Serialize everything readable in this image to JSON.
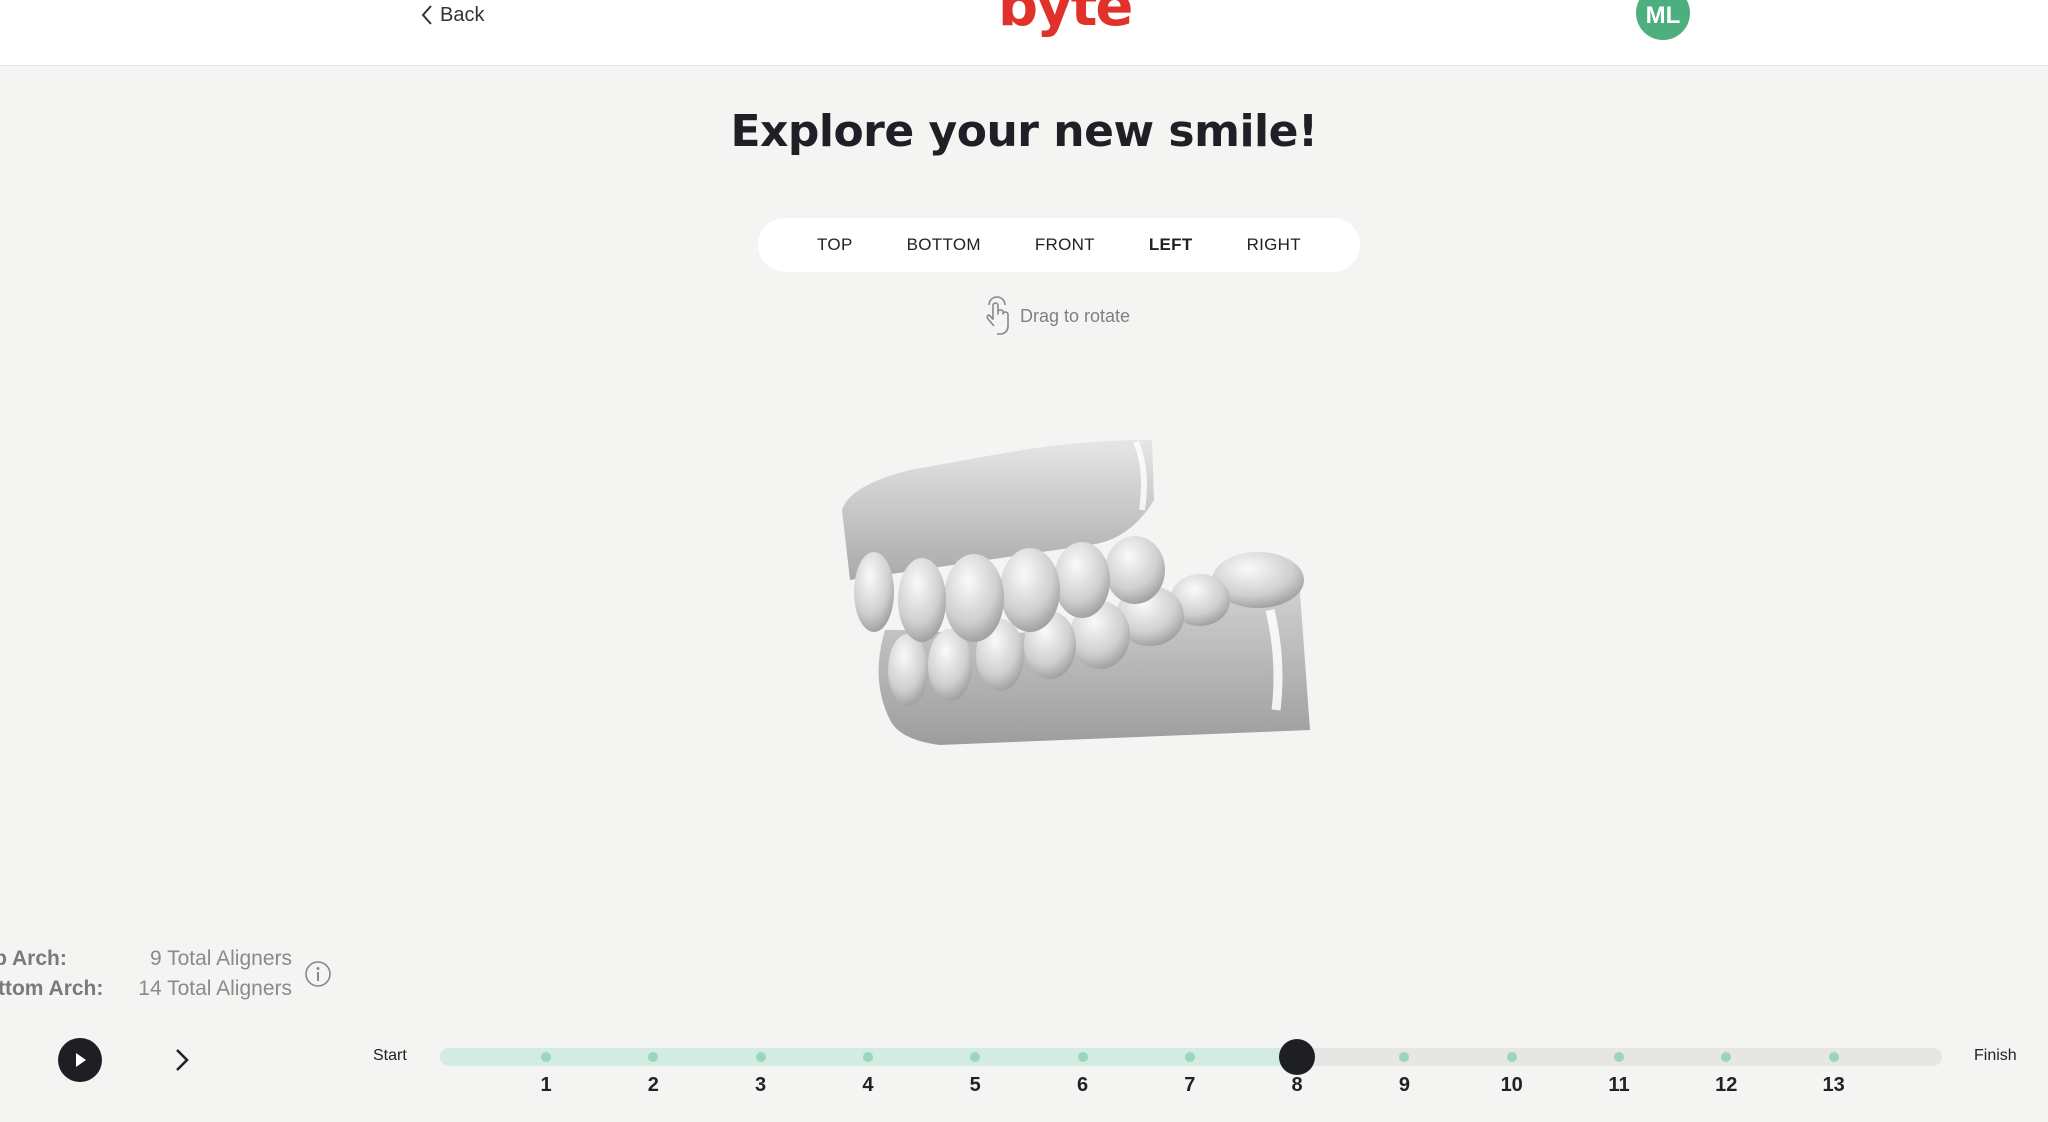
{
  "header": {
    "back_label": "Back",
    "logo_text": "byte",
    "avatar_initials": "ML",
    "avatar_color": "#4caf7d",
    "logo_color": "#e0312a"
  },
  "page": {
    "title": "Explore your new smile!"
  },
  "view_tabs": [
    {
      "label": "TOP",
      "active": false
    },
    {
      "label": "BOTTOM",
      "active": false
    },
    {
      "label": "FRONT",
      "active": false
    },
    {
      "label": "LEFT",
      "active": true
    },
    {
      "label": "RIGHT",
      "active": false
    }
  ],
  "drag_hint": {
    "icon": "hand-drag-icon",
    "text": "Drag to rotate"
  },
  "model": {
    "icon": "teeth-3d-model"
  },
  "aligners": {
    "top_label": "Top Arch:",
    "top_value": "9 Total Aligners",
    "bottom_label": "Bottom Arch:",
    "bottom_value": "14 Total Aligners",
    "info_icon": "info-icon"
  },
  "timeline": {
    "start_label": "Start",
    "finish_label": "Finish",
    "steps": [
      "1",
      "2",
      "3",
      "4",
      "5",
      "6",
      "7",
      "8",
      "9",
      "10",
      "11",
      "12",
      "13"
    ],
    "current_step": 8,
    "play_icon": "play-icon",
    "next_icon": "chevron-right-icon",
    "fill_color": "#d3ece3",
    "dot_color": "#9bd6ba"
  }
}
